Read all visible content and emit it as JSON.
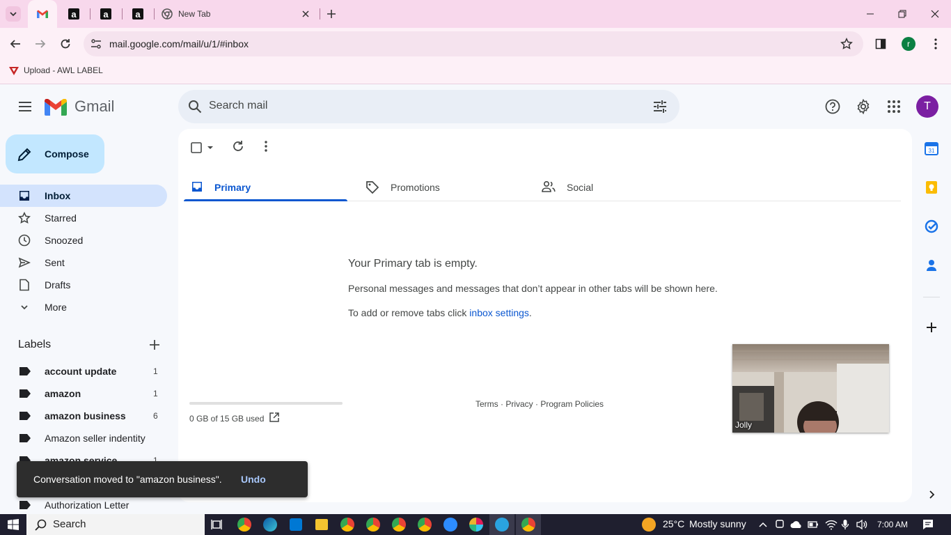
{
  "browser": {
    "tabs": [
      {
        "label": "",
        "icon": "gmail-icon"
      },
      {
        "label": "",
        "icon": "amazon-icon"
      },
      {
        "label": "",
        "icon": "amazon-icon"
      },
      {
        "label": "",
        "icon": "amazon-icon"
      },
      {
        "label": "New Tab",
        "icon": "chrome-icon"
      }
    ],
    "url": "mail.google.com/mail/u/1/#inbox",
    "profile_initial": "r",
    "bookmark_label": "Upload - AWL LABEL"
  },
  "gmail": {
    "brand": "Gmail",
    "search_placeholder": "Search mail",
    "account_initial": "T",
    "compose_label": "Compose",
    "nav": [
      {
        "label": "Inbox",
        "icon": "inbox-icon",
        "active": true
      },
      {
        "label": "Starred",
        "icon": "star-icon"
      },
      {
        "label": "Snoozed",
        "icon": "clock-icon"
      },
      {
        "label": "Sent",
        "icon": "send-icon"
      },
      {
        "label": "Drafts",
        "icon": "draft-icon"
      },
      {
        "label": "More",
        "icon": "chevron-down-icon"
      }
    ],
    "labels_header": "Labels",
    "labels": [
      {
        "name": "account update",
        "count": "1",
        "bold": true
      },
      {
        "name": "amazon",
        "count": "1",
        "bold": true
      },
      {
        "name": "amazon business",
        "count": "6",
        "bold": true
      },
      {
        "name": "Amazon seller indentity",
        "count": "",
        "bold": false
      },
      {
        "name": "amazon service",
        "count": "1",
        "bold": true
      },
      {
        "name": "",
        "count": "",
        "bold": false
      },
      {
        "name": "Authorization Letter",
        "count": "",
        "bold": false
      }
    ],
    "tabs": [
      {
        "label": "Primary",
        "icon": "inbox-icon",
        "active": true
      },
      {
        "label": "Promotions",
        "icon": "tag-icon"
      },
      {
        "label": "Social",
        "icon": "people-icon"
      }
    ],
    "empty": {
      "title": "Your Primary tab is empty.",
      "line1": "Personal messages and messages that don’t appear in other tabs will be shown here.",
      "line2_prefix": "To add or remove tabs click ",
      "line2_link": "inbox settings",
      "line2_suffix": "."
    },
    "storage": "0 GB of 15 GB used",
    "storage_fraction": 0.0,
    "footer_links": [
      "Terms",
      "Privacy",
      "Program Policies"
    ],
    "footer_sep": " · ",
    "video_name": "Jolly",
    "toast": {
      "message": "Conversation moved to \"amazon business\".",
      "action": "Undo"
    }
  },
  "taskbar": {
    "search": "Search",
    "weather_temp": "25°C",
    "weather_desc": "Mostly sunny",
    "time": "7:00 AM"
  }
}
